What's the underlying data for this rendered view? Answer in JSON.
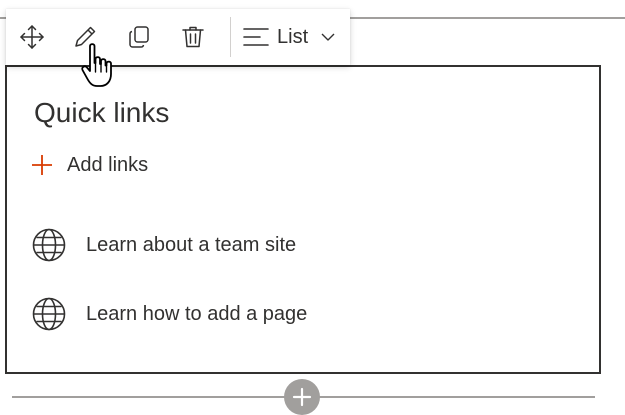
{
  "toolbar": {
    "buttons": [
      {
        "name": "move",
        "icon": "move-icon"
      },
      {
        "name": "edit",
        "icon": "pencil-icon"
      },
      {
        "name": "duplicate",
        "icon": "copy-icon"
      },
      {
        "name": "delete",
        "icon": "trash-icon"
      }
    ],
    "layout_label": "List",
    "layout_icon": "list-lines-icon",
    "dropdown_icon": "chevron-down-icon"
  },
  "webpart": {
    "title": "Quick links",
    "add_links_label": "Add links",
    "links": [
      {
        "label": "Learn about a team site",
        "icon": "globe-icon"
      },
      {
        "label": "Learn how to add a page",
        "icon": "globe-icon"
      }
    ]
  },
  "section": {
    "add_icon": "plus-icon"
  },
  "colors": {
    "accent_plus": "#d83b01",
    "text": "#323130",
    "divider": "#a19f9d",
    "frame": "#323130"
  }
}
